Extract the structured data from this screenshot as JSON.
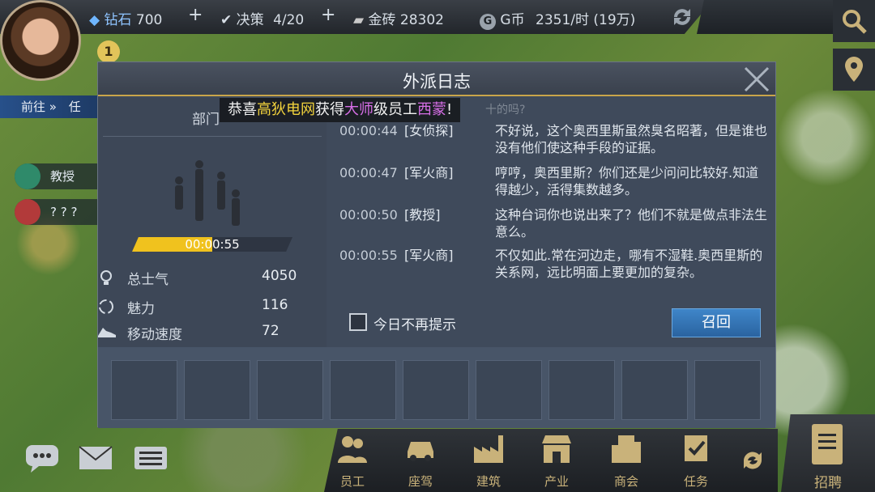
{
  "topbar": {
    "diamond_label": "钻石",
    "diamond_value": "700",
    "decision_label": "决策",
    "decision_value": "4/20",
    "gold_label": "金砖",
    "gold_value": "28302",
    "gcoin_label": "G币",
    "gcoin_value": "2351/时 (19万)",
    "plus": "+"
  },
  "player": {
    "level": "1"
  },
  "left_hud": {
    "goto_label": "前往 »",
    "task_label": "任",
    "pill1_label": "教授",
    "pill2_label": "? ? ?"
  },
  "dialog": {
    "title": "外派日志",
    "congrats": {
      "prefix": "恭喜",
      "company": "高狄电网",
      "mid1": "获得",
      "rank": "大师",
      "mid2": "级员工",
      "name": "西蒙",
      "suffix": "!"
    },
    "dept_label": "部门",
    "timer": "00:00:55",
    "timer_progress_percent": 50,
    "stats": [
      {
        "label": "总士气",
        "value": "4050",
        "icon": "lightbulb-icon"
      },
      {
        "label": "魅力",
        "value": "116",
        "icon": "charm-icon"
      },
      {
        "label": "移动速度",
        "value": "72",
        "icon": "shoe-icon"
      }
    ],
    "log_partial_top": "十的吗?",
    "log": [
      {
        "time": "00:00:44",
        "who": "[女侦探]",
        "text": "不好说，这个奥西里斯虽然臭名昭著，但是谁也没有他们使这种手段的证据。"
      },
      {
        "time": "00:00:47",
        "who": "[军火商]",
        "text": "哼哼，奥西里斯？你们还是少问问比较好.知道得越少，活得集数越多。"
      },
      {
        "time": "00:00:50",
        "who": "[教授]",
        "text": "这种台词你也说出来了？他们不就是做点非法生意么。"
      },
      {
        "time": "00:00:55",
        "who": "[军火商]",
        "text": "不仅如此.常在河边走，哪有不湿鞋.奥西里斯的关系网，远比明面上要更加的复杂。"
      }
    ],
    "checkbox_label": "今日不再提示",
    "recall_label": "召回"
  },
  "bottom_nav": [
    {
      "label": "员工",
      "icon": "employee-icon"
    },
    {
      "label": "座驾",
      "icon": "car-icon"
    },
    {
      "label": "建筑",
      "icon": "factory-icon"
    },
    {
      "label": "产业",
      "icon": "shop-icon"
    },
    {
      "label": "商会",
      "icon": "building-icon"
    },
    {
      "label": "任务",
      "icon": "task-flag-icon"
    }
  ],
  "recruit_label": "招聘"
}
